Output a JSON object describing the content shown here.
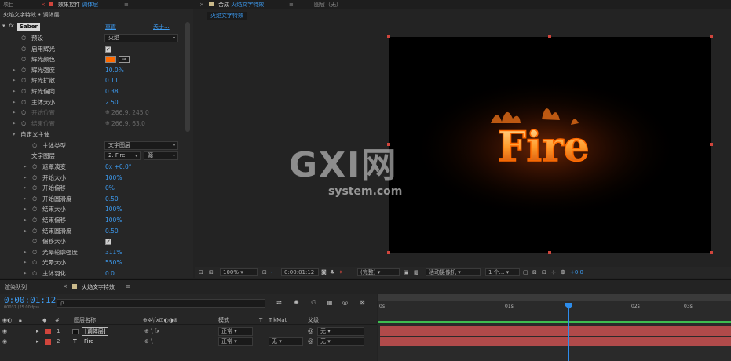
{
  "top_tabs": {
    "project": "项目",
    "effects_controls_prefix": "效果控件",
    "effects_controls_layer": "调体层",
    "composition_prefix": "合成",
    "composition_name": "火焰文字特效",
    "layer_panel": "图层（无）"
  },
  "effects_controls": {
    "breadcrumb": "火焰文字特效 • 调体层",
    "effect_name": "Saber",
    "reset_label": "重置",
    "about_label": "关于...",
    "rows": [
      {
        "label": "预设",
        "type": "select",
        "value": "火焰"
      },
      {
        "label": "启用辉光",
        "type": "check"
      },
      {
        "label": "辉光颜色",
        "type": "color",
        "color": "#ff6a00"
      },
      {
        "label": "辉光强度",
        "type": "value",
        "value": "10.0",
        "unit": "%"
      },
      {
        "label": "辉光扩散",
        "type": "value",
        "value": "0.11"
      },
      {
        "label": "辉光偏向",
        "type": "value",
        "value": "0.38"
      },
      {
        "label": "主体大小",
        "type": "value",
        "value": "2.50"
      },
      {
        "label": "开始位置",
        "type": "disabled",
        "value": "266.9, 245.0"
      },
      {
        "label": "结束位置",
        "type": "disabled",
        "value": "266.9, 63.0"
      },
      {
        "label": "自定义主体",
        "type": "group"
      },
      {
        "label": "主体类型",
        "type": "select",
        "value": "文字图层"
      },
      {
        "label": "文字图层",
        "type": "select2",
        "value": "2. Fire",
        "value2": "源"
      },
      {
        "label": "遮罩演变",
        "type": "value",
        "value": "0x +0.0°"
      },
      {
        "label": "开始大小",
        "type": "value",
        "value": "100",
        "unit": "%"
      },
      {
        "label": "开始偏移",
        "type": "value",
        "value": "0",
        "unit": "%"
      },
      {
        "label": "开始圆滑度",
        "type": "value",
        "value": "0.50"
      },
      {
        "label": "结束大小",
        "type": "value",
        "value": "100",
        "unit": "%"
      },
      {
        "label": "结束偏移",
        "type": "value",
        "value": "100",
        "unit": "%"
      },
      {
        "label": "结束圆滑度",
        "type": "value",
        "value": "0.50"
      },
      {
        "label": "偏移大小",
        "type": "check"
      },
      {
        "label": "光晕轮廓强度",
        "type": "value",
        "value": "311",
        "unit": "%"
      },
      {
        "label": "光晕大小",
        "type": "value",
        "value": "550",
        "unit": "%"
      },
      {
        "label": "主体羽化",
        "type": "value",
        "value": "0.0"
      }
    ]
  },
  "composition": {
    "sub_tab": "火焰文字特效",
    "fire_text": "Fire",
    "watermark": {
      "big": "GXI网",
      "small": "system.com"
    }
  },
  "viewer_toolbar": {
    "zoom": "100%",
    "timecode": "0:00:01:12",
    "resolution": "(完整)",
    "camera": "活动摄像机",
    "views": "1 个...",
    "exposure": "+0.0"
  },
  "timeline": {
    "tab_render_queue": "渲染队列",
    "tab_comp": "火焰文字特效",
    "current_time": "0:00:01:12",
    "frame_info": "00037 (25.00 fps)",
    "search_placeholder": "ρ.",
    "col_num": "#",
    "col_layer_name": "图层名称",
    "col_mode": "模式",
    "col_t": "T",
    "col_trkmat": "TrkMat",
    "col_parent": "父级",
    "ruler": [
      "0s",
      "01s",
      "02s",
      "03s"
    ],
    "layers": [
      {
        "num": "1",
        "name": "[调体层]",
        "mode": "正常",
        "trkmat": "",
        "parent": "无"
      },
      {
        "num": "2",
        "name": "Fire",
        "mode": "正常",
        "trkmat": "无",
        "parent": "无"
      }
    ]
  },
  "colors": {
    "accent": "#3d9bf0",
    "label_red": "#d0453c",
    "playhead": "#2d8ceb",
    "layer_bar": "#b04a4a"
  }
}
